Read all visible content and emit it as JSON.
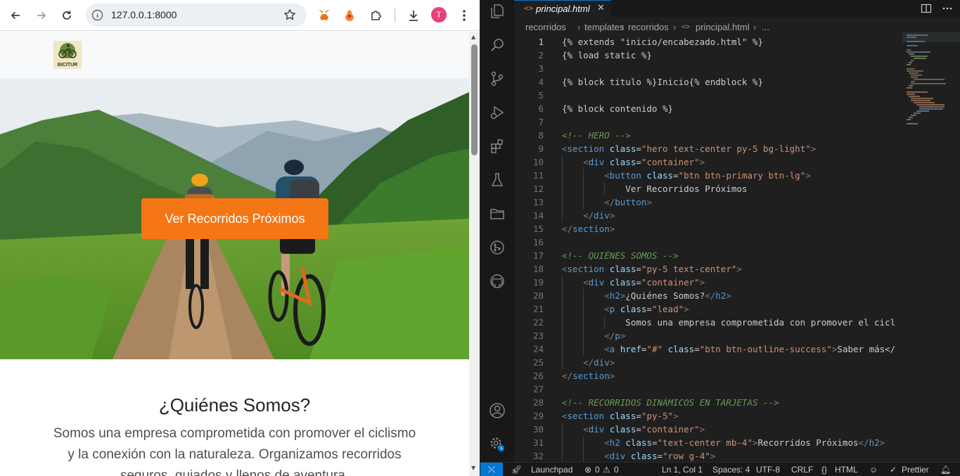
{
  "browser": {
    "url": "127.0.0.1:8000",
    "profile_initial": "T"
  },
  "site": {
    "logo_text": "BICITUR",
    "hero_button": "Ver Recorridos Próximos",
    "about_title": "¿Quiénes Somos?",
    "about_lines": [
      "Somos una empresa comprometida con promover el ciclismo",
      "y la conexión con la naturaleza. Organizamos recorridos",
      "seguros, guiados y llenos de aventura."
    ]
  },
  "editor": {
    "tab_label": "principal.html",
    "breadcrumb": [
      "recorridos",
      "templates",
      "recorridos",
      "principal.html",
      "..."
    ],
    "lines": [
      {
        "n": "1",
        "code": "{% extends \"inicio/encabezado.html\" %}"
      },
      {
        "n": "2",
        "code": "{% load static %}"
      },
      {
        "n": "3",
        "code": ""
      },
      {
        "n": "4",
        "code": "{% block titulo %}Inicio{% endblock %}"
      },
      {
        "n": "5",
        "code": ""
      },
      {
        "n": "6",
        "code": "{% block contenido %}"
      },
      {
        "n": "7",
        "code": ""
      },
      {
        "n": "8",
        "code": "<!-- HERO -->"
      },
      {
        "n": "9",
        "code": "<section class=\"hero text-center py-5 bg-light\">"
      },
      {
        "n": "10",
        "code": "    <div class=\"container\">"
      },
      {
        "n": "11",
        "code": "        <button class=\"btn btn-primary btn-lg\">"
      },
      {
        "n": "12",
        "code": "            Ver Recorridos Próximos"
      },
      {
        "n": "13",
        "code": "        </button>"
      },
      {
        "n": "14",
        "code": "    </div>"
      },
      {
        "n": "15",
        "code": "</section>"
      },
      {
        "n": "16",
        "code": ""
      },
      {
        "n": "17",
        "code": "<!-- QUIÉNES SOMOS -->"
      },
      {
        "n": "18",
        "code": "<section class=\"py-5 text-center\">"
      },
      {
        "n": "19",
        "code": "    <div class=\"container\">"
      },
      {
        "n": "20",
        "code": "        <h2>¿Quiénes Somos?</h2>"
      },
      {
        "n": "21",
        "code": "        <p class=\"lead\">"
      },
      {
        "n": "22",
        "code": "            Somos una empresa comprometida con promover el cicl"
      },
      {
        "n": "23",
        "code": "        </p>"
      },
      {
        "n": "24",
        "code": "        <a href=\"#\" class=\"btn btn-outline-success\">Saber más</"
      },
      {
        "n": "25",
        "code": "    </div>"
      },
      {
        "n": "26",
        "code": "</section>"
      },
      {
        "n": "27",
        "code": ""
      },
      {
        "n": "28",
        "code": "<!-- RECORRIDOS DINÁMICOS EN TARJETAS -->"
      },
      {
        "n": "29",
        "code": "<section class=\"py-5\">"
      },
      {
        "n": "30",
        "code": "    <div class=\"container\">"
      },
      {
        "n": "31",
        "code": "        <h2 class=\"text-center mb-4\">Recorridos Próximos</h2>"
      },
      {
        "n": "32",
        "code": "        <div class=\"row g-4\">"
      }
    ]
  },
  "status": {
    "launchpad": "Launchpad",
    "errors": "0",
    "warnings": "0",
    "position": "Ln 1, Col 1",
    "spaces": "Spaces: 4",
    "encoding": "UTF-8",
    "eol": "CRLF",
    "language": "HTML",
    "formatter": "Prettier"
  },
  "colors": {
    "hero_button": "#f57614",
    "vscode_accent": "#0078d4",
    "tag": "#569cd6",
    "attr": "#9cdcfe",
    "string": "#ce9178",
    "comment": "#6a9955"
  }
}
